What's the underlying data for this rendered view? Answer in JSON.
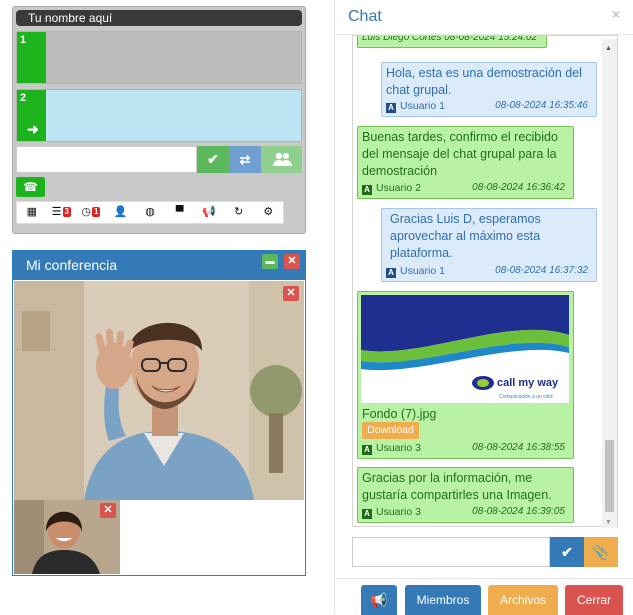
{
  "phone": {
    "name_placeholder": "Tu nombre aquí",
    "lines": [
      {
        "number": "1"
      },
      {
        "number": "2",
        "arrow": "➜"
      }
    ],
    "dial_value": "",
    "toolbar_badges": {
      "voicemail": "3",
      "missed_calls": "1"
    }
  },
  "conference": {
    "title": "Mi conferencia"
  },
  "chat": {
    "title": "Chat",
    "close_glyph": "×",
    "truncated_header": "Luis Diego Cortés 08-08-2024 15:24:02",
    "messages": [
      {
        "text": "Hola, esta es una demostración del chat grupal.",
        "user": "Usuario 1",
        "time": "08-08-2024 16:35:46",
        "side": "mine"
      },
      {
        "text": "Buenas tardes, confirmo el recibido del mensaje del chat grupal para la demostración",
        "user": "Usuario 2",
        "time": "08-08-2024 16:36:42",
        "side": "other"
      },
      {
        "text": "Gracias Luis D, esperamos aprovechar al máximo esta plataforma.",
        "user": "Usuario 1",
        "time": "08-08-2024 16:37:32",
        "side": "mine"
      },
      {
        "text": "",
        "user": "Usuario 3",
        "time": "08-08-2024 16:38:55",
        "side": "other",
        "attachment": {
          "filename": "Fondo (7).jpg",
          "download_label": "Download",
          "logo_text": "call my way",
          "logo_tagline": "Comunicación a un click"
        }
      },
      {
        "text": "Gracias por la información, me gustaría compartirles una Imagen.",
        "user": "Usuario 3",
        "time": "08-08-2024 16:39:05",
        "side": "other"
      }
    ],
    "input_value": "",
    "buttons": {
      "members": "Miembros",
      "files": "Archivos",
      "close": "Cerrar"
    }
  },
  "colors": {
    "primary": "#337ab7",
    "success": "#5cb85c",
    "warning": "#f0ad4e",
    "danger": "#d9534f",
    "chat_mine_bg": "#dcebfa",
    "chat_other_bg": "#b9f2a4"
  }
}
